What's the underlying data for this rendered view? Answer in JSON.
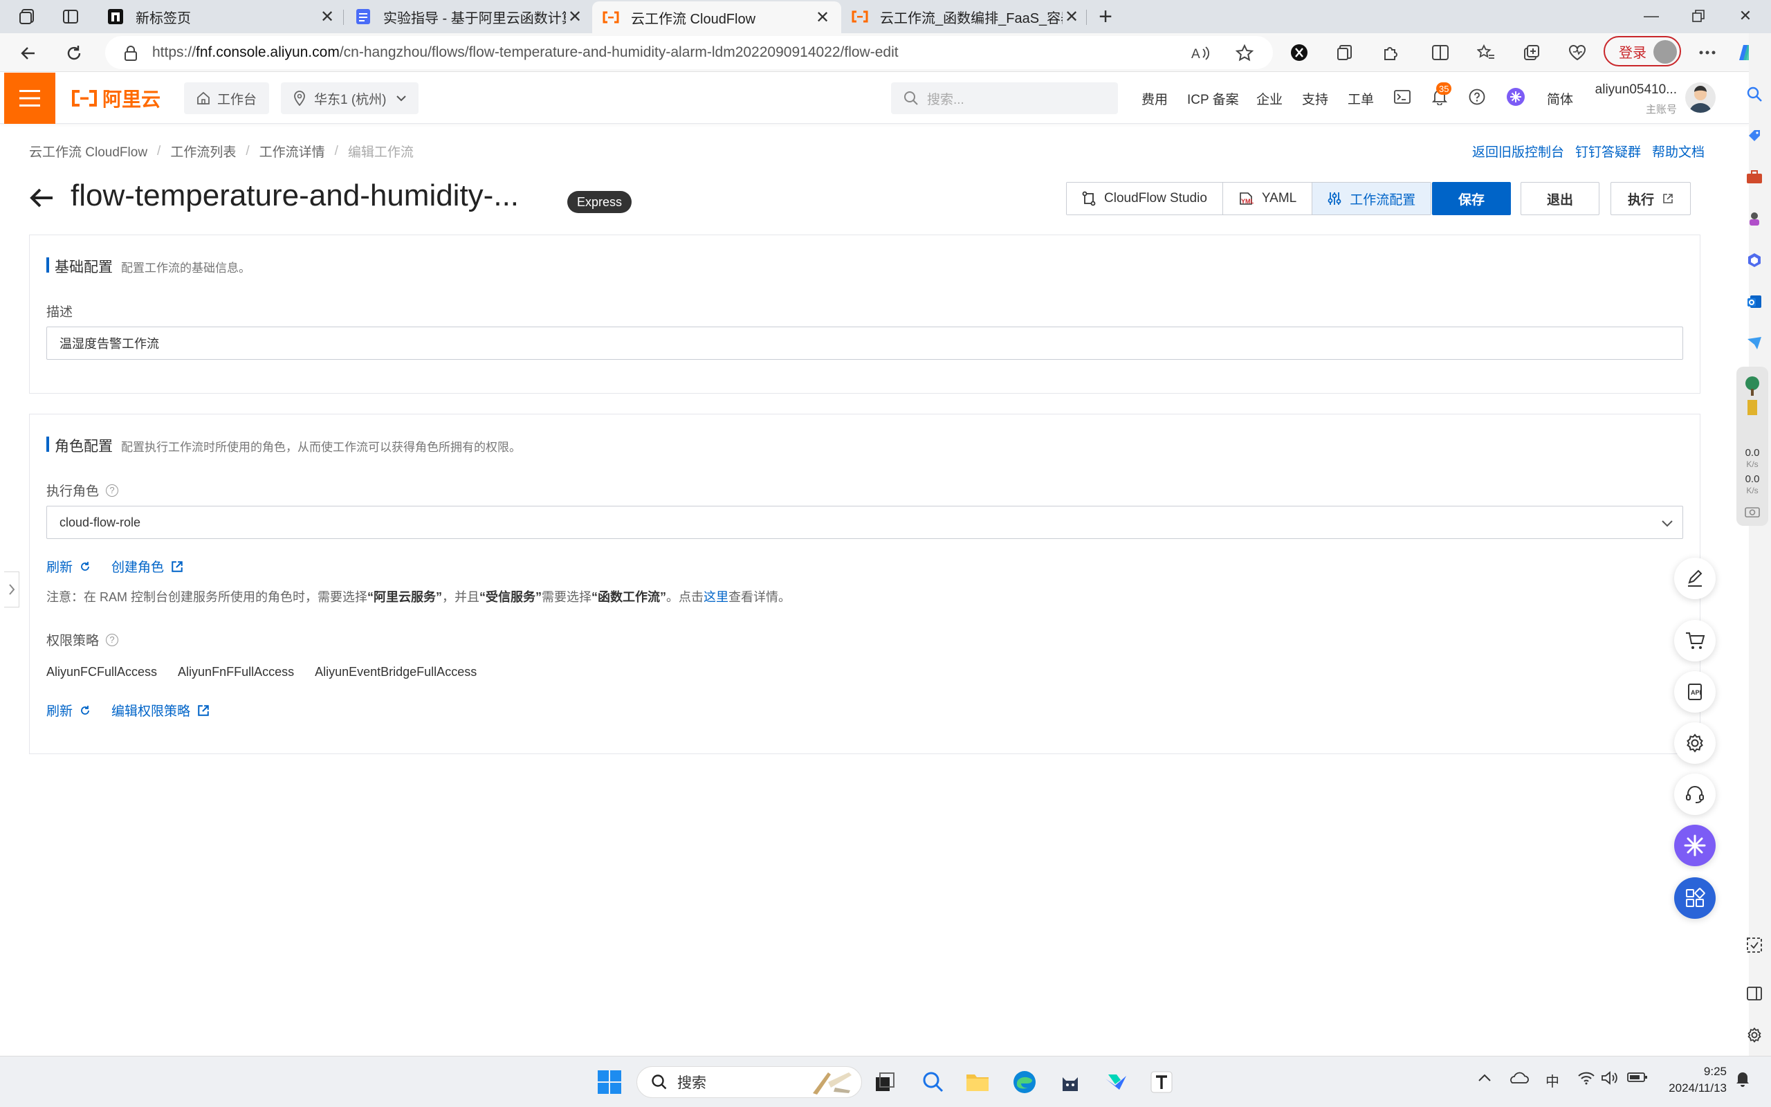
{
  "browser": {
    "tabs": [
      {
        "title": "新标签页"
      },
      {
        "title": "实验指导 - 基于阿里云函数计算的"
      },
      {
        "title": "云工作流 CloudFlow"
      },
      {
        "title": "云工作流_函数编排_FaaS_容器与"
      }
    ],
    "url_scheme": "https://",
    "url_host": "fnf.console.aliyun.com",
    "url_path": "/cn-hangzhou/flows/flow-temperature-and-humidity-alarm-ldm2022090914022/flow-edit",
    "login_label": "登录"
  },
  "console": {
    "logo_text": "阿里云",
    "workbench": "工作台",
    "region": "华东1 (杭州)",
    "search_placeholder": "搜索...",
    "nav_links": [
      "费用",
      "ICP 备案",
      "企业",
      "支持",
      "工单"
    ],
    "notification_count": "35",
    "language": "简体",
    "account_name": "aliyun05410...",
    "account_role": "主账号"
  },
  "breadcrumb": [
    "云工作流 CloudFlow",
    "工作流列表",
    "工作流详情",
    "编辑工作流"
  ],
  "top_links": [
    "返回旧版控制台",
    "钉钉答疑群",
    "帮助文档"
  ],
  "page": {
    "title": "flow-temperature-and-humidity-...",
    "badge": "Express",
    "segments": [
      "CloudFlow Studio",
      "YAML",
      "工作流配置"
    ],
    "active_segment": "工作流配置",
    "save": "保存",
    "exit": "退出",
    "execute": "执行"
  },
  "basic": {
    "title": "基础配置",
    "desc": "配置工作流的基础信息。",
    "label_desc": "描述",
    "desc_value": "温湿度告警工作流"
  },
  "role": {
    "title": "角色配置",
    "desc": "配置执行工作流时所使用的角色，从而使工作流可以获得角色所拥有的权限。",
    "label_role": "执行角色",
    "role_value": "cloud-flow-role",
    "refresh": "刷新",
    "create_role": "创建角色",
    "note_1": "注意：在 RAM 控制台创建服务所使用的角色时，需要选择",
    "note_b1": "“阿里云服务”",
    "note_2": "，并且",
    "note_b2": "“受信服务”",
    "note_3": "需要选择",
    "note_b3": "“函数工作流”",
    "note_4": "。点击",
    "note_link": "这里",
    "note_5": "查看详情。",
    "label_policy": "权限策略",
    "policies": [
      "AliyunFCFullAccess",
      "AliyunFnFFullAccess",
      "AliyunEventBridgeFullAccess"
    ],
    "edit_policy": "编辑权限策略"
  },
  "edge": {
    "speed_up": "0.0",
    "speed_down": "0.0",
    "speed_unit": "K/s"
  },
  "taskbar": {
    "search": "搜索",
    "ime": "中",
    "time": "9:25",
    "date": "2024/11/13"
  }
}
